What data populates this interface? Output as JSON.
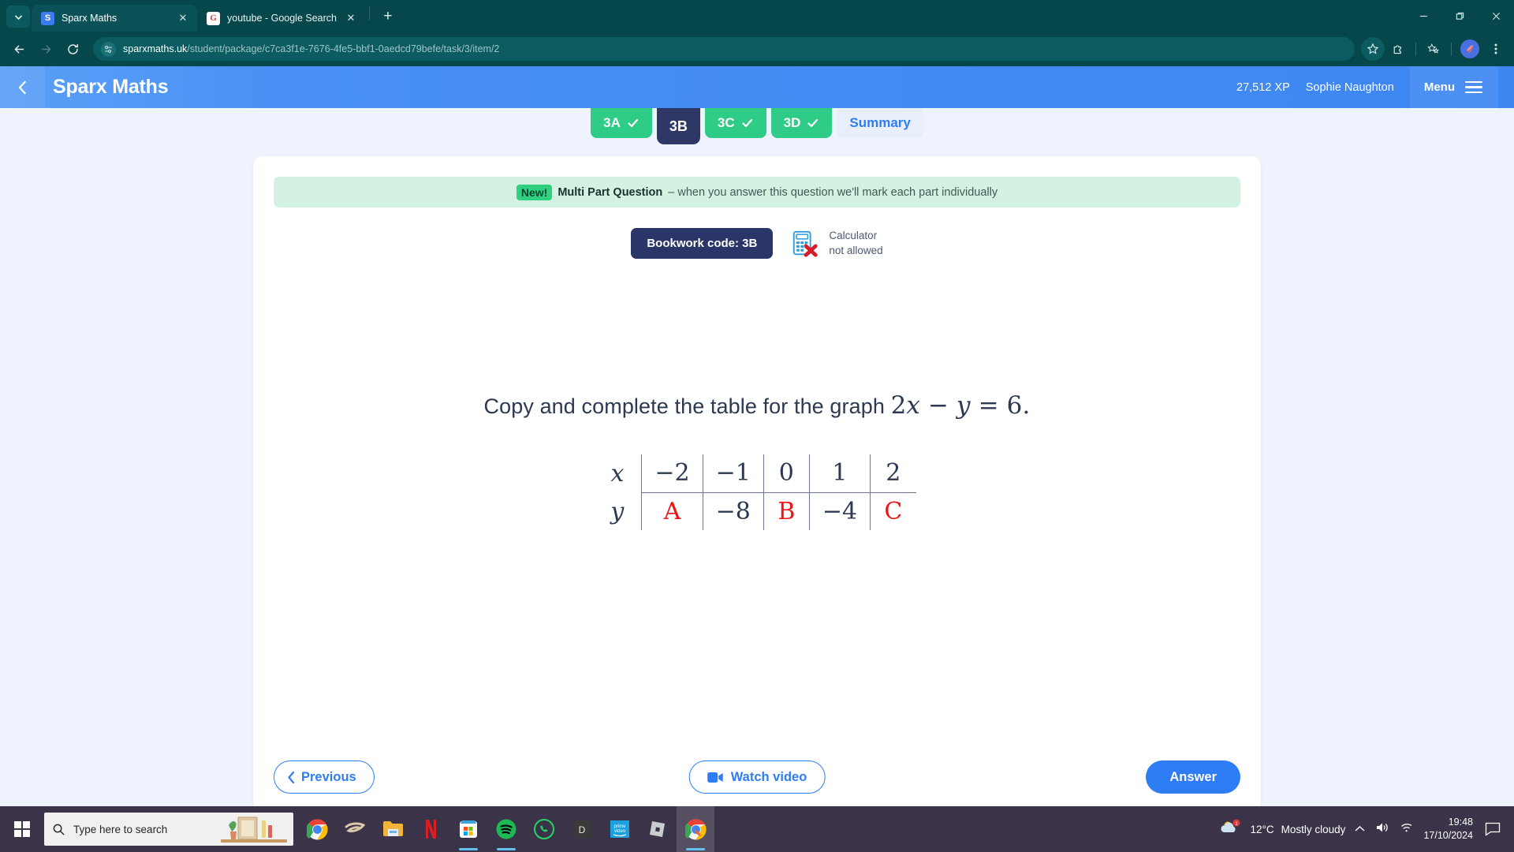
{
  "browser": {
    "tabs": [
      {
        "title": "Sparx Maths",
        "favicon": "sparx-favicon",
        "favicon_letter": "S",
        "active": true
      },
      {
        "title": "youtube - Google Search",
        "favicon": "google-favicon",
        "favicon_letter": "G",
        "active": false
      }
    ],
    "new_tab_label": "+",
    "close_label": "✕",
    "url_domain": "sparxmaths.uk",
    "url_path": "/student/package/c7ca3f1e-7676-4fe5-bbf1-0aedcd79befe/task/3/item/2",
    "window_controls": {
      "minimize": "minimize-button",
      "maximize": "maximize-button",
      "close": "close-button"
    }
  },
  "app_header": {
    "brand": "Sparx Maths",
    "xp": "27,512 XP",
    "user": "Sophie Naughton",
    "menu_label": "Menu"
  },
  "task_tabs": [
    {
      "label": "3A",
      "state": "done"
    },
    {
      "label": "3B",
      "state": "current"
    },
    {
      "label": "3C",
      "state": "done"
    },
    {
      "label": "3D",
      "state": "done"
    },
    {
      "label": "Summary",
      "state": "summary"
    }
  ],
  "banner": {
    "badge": "New!",
    "title": "Multi Part Question",
    "text": "– when you answer this question we'll mark each part individually"
  },
  "meta": {
    "bookwork_code": "Bookwork code: 3B",
    "calculator_line1": "Calculator",
    "calculator_line2": "not allowed"
  },
  "question": {
    "prompt_plain": "Copy and complete the table for the graph",
    "equation_coef": "2",
    "equation_x": "x",
    "equation_minus": "−",
    "equation_y": "y",
    "equation_eq": "=",
    "equation_value": "6",
    "equation_period": "."
  },
  "table": {
    "row_labels": [
      "x",
      "y"
    ],
    "x_values": [
      "−2",
      "−1",
      "0",
      "1",
      "2"
    ],
    "y_values": [
      "A",
      "−8",
      "B",
      "−4",
      "C"
    ],
    "unknown_cells": [
      0,
      2,
      4
    ],
    "unknown_color": "#f01414"
  },
  "footer": {
    "previous": "Previous",
    "watch_video": "Watch video",
    "answer": "Answer"
  },
  "taskbar": {
    "search_placeholder": "Type here to search",
    "apps": [
      {
        "name": "chrome"
      },
      {
        "name": "spiral"
      },
      {
        "name": "file-explorer"
      },
      {
        "name": "netflix"
      },
      {
        "name": "microsoft-store"
      },
      {
        "name": "spotify"
      },
      {
        "name": "whatsapp"
      },
      {
        "name": "d-app"
      },
      {
        "name": "prime-video"
      },
      {
        "name": "roblox"
      },
      {
        "name": "chrome-active"
      }
    ],
    "weather_temp": "12°C",
    "weather_desc": "Mostly cloudy",
    "notification_count": "1",
    "time": "19:48",
    "date": "17/10/2024"
  },
  "colors": {
    "browser_chrome": "#06474c",
    "sparx_blue": "#3d86f2",
    "accent_blue": "#2f7df4",
    "tab_done_green": "#2ecc87",
    "tab_current_navy": "#2e3766",
    "banner_green": "#d4f2e1",
    "bookwork_navy": "#2b3668",
    "page_bg": "#eef3fd"
  }
}
